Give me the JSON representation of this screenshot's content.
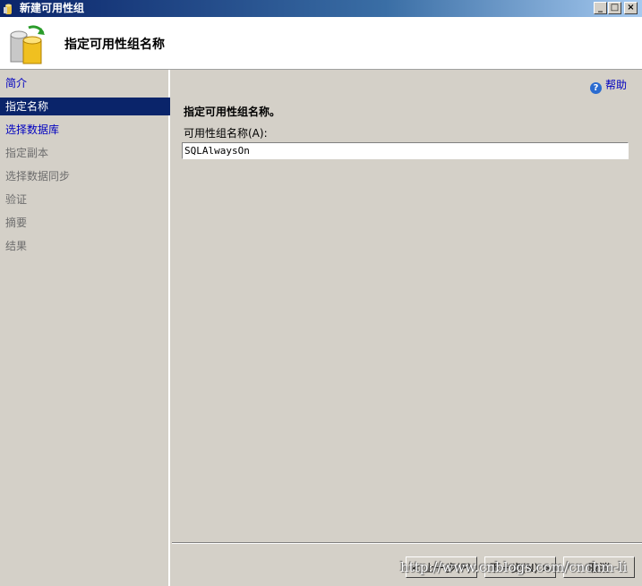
{
  "window": {
    "title": "新建可用性组",
    "minimize_label": "_",
    "maximize_label": "□",
    "close_label": "×"
  },
  "header": {
    "heading": "指定可用性组名称"
  },
  "sidebar": {
    "items": [
      {
        "label": "简介",
        "state": "link"
      },
      {
        "label": "指定名称",
        "state": "selected"
      },
      {
        "label": "选择数据库",
        "state": "link"
      },
      {
        "label": "指定副本",
        "state": "disabled"
      },
      {
        "label": "选择数据同步",
        "state": "disabled"
      },
      {
        "label": "验证",
        "state": "disabled"
      },
      {
        "label": "摘要",
        "state": "disabled"
      },
      {
        "label": "结果",
        "state": "disabled"
      }
    ]
  },
  "main": {
    "help_label": "帮助",
    "section_title": "指定可用性组名称。",
    "field_label": "可用性组名称(A):",
    "field_value": "SQLAlwaysOn"
  },
  "footer": {
    "prev_label": "< 上一步(P)",
    "next_label": "下一步(N) >",
    "cancel_label": "取消"
  },
  "watermark": "http://www.cnblogs.com/cnchm-li"
}
